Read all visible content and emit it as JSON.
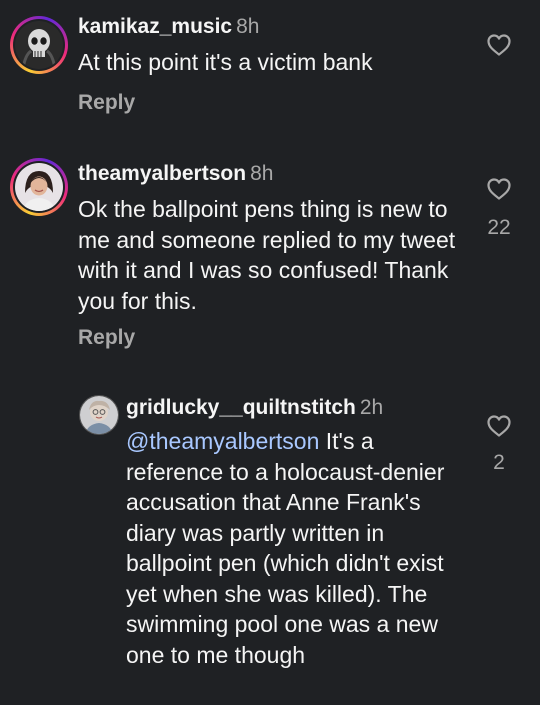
{
  "comments": [
    {
      "username": "kamikaz_music",
      "time": "8h",
      "text": "At this point it's a victim bank",
      "reply_label": "Reply",
      "likes": "",
      "avatar_icon": "skull-avatar-icon"
    },
    {
      "username": "theamyalbertson",
      "time": "8h",
      "text": "Ok the ballpoint pens thing is new to me and someone replied to my tweet with it and I was so confused! Thank you for this.",
      "reply_label": "Reply",
      "likes": "22",
      "avatar_icon": "woman-avatar-icon"
    },
    {
      "username": "gridlucky__quiltnstitch",
      "time": "2h",
      "mention": "@theamyalbertson",
      "text": " It's a reference to a holocaust-denier accusation that Anne Frank's diary was partly written in ballpoint pen (which didn't exist yet when she was killed). The swimming pool one was a new one to me though",
      "likes": "2",
      "avatar_icon": "person-avatar-icon"
    }
  ],
  "colors": {
    "background": "#1f2124",
    "text": "#f5f5f5",
    "muted": "#a8a8a8",
    "mention": "#a9c8ff"
  }
}
